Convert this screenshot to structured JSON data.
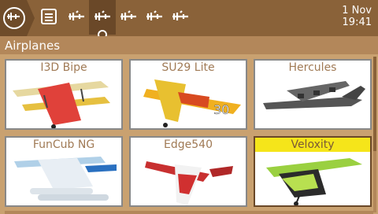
{
  "topbar": {
    "home_icon": "airplane-home-icon",
    "menu_icon": "hamburger-menu-icon",
    "tabs": [
      {
        "icon": "model-setup-icon",
        "active": false
      },
      {
        "icon": "model-select-icon",
        "active": true
      },
      {
        "icon": "model-mixes-icon",
        "active": false
      },
      {
        "icon": "model-outputs-icon",
        "active": false
      },
      {
        "icon": "model-curves-icon",
        "active": false
      }
    ],
    "date": "1 Nov",
    "time": "19:41"
  },
  "category": {
    "title": "Airplanes"
  },
  "models": [
    {
      "name": "I3D Bipe",
      "selected": false
    },
    {
      "name": "SU29 Lite",
      "selected": false
    },
    {
      "name": "Hercules",
      "selected": false
    },
    {
      "name": "FunCub NG",
      "selected": false
    },
    {
      "name": "Edge540",
      "selected": false
    },
    {
      "name": "Veloxity",
      "selected": true
    }
  ],
  "colors": {
    "accent": "#8a6239",
    "selected_title_bg": "#f5e51a",
    "background": "#c9a170"
  }
}
